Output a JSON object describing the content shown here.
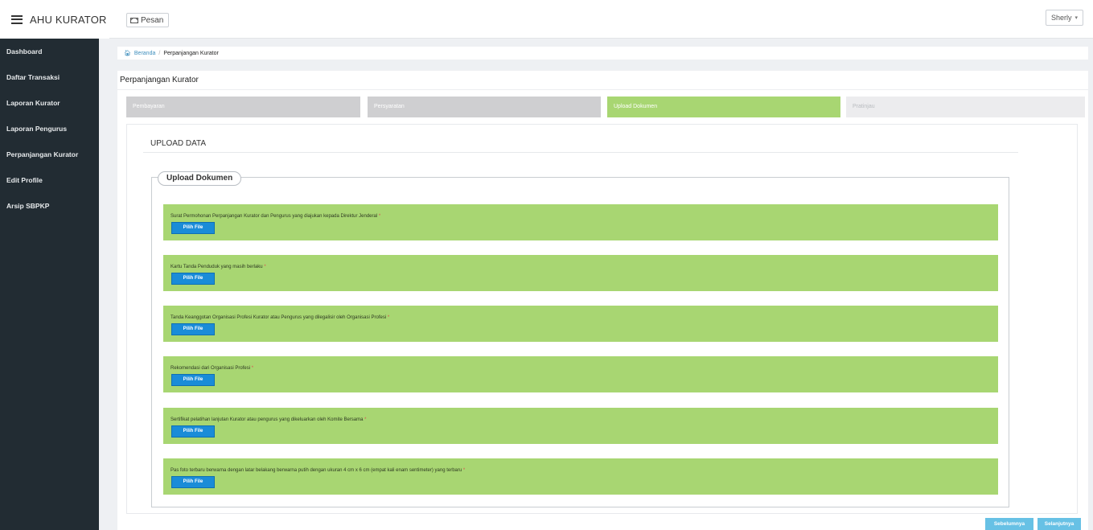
{
  "app": {
    "title": "AHU KURATOR"
  },
  "header": {
    "message_label": "Pesan",
    "user_label": "Sherly"
  },
  "sidebar": {
    "items": [
      {
        "label": "Dashboard"
      },
      {
        "label": "Daftar Transaksi"
      },
      {
        "label": "Laporan Kurator"
      },
      {
        "label": "Laporan Pengurus"
      },
      {
        "label": "Perpanjangan Kurator"
      },
      {
        "label": "Edit Profile"
      },
      {
        "label": "Arsip SBPKP"
      }
    ]
  },
  "breadcrumb": {
    "home": "Beranda",
    "current": "Perpanjangan Kurator"
  },
  "page": {
    "title": "Perpanjangan Kurator"
  },
  "steps": [
    {
      "label": "Pembayaran",
      "state": "done"
    },
    {
      "label": "Persyaratan",
      "state": "done"
    },
    {
      "label": "Upload Dokumen",
      "state": "current"
    },
    {
      "label": "Pratinjau",
      "state": "todo"
    }
  ],
  "section": {
    "title": "UPLOAD DATA",
    "legend": "Upload Dokumen"
  },
  "documents": [
    {
      "label": "Surat Permohonan Perpanjangan Kurator dan Pengurus yang diajukan kepada Direktur Jenderal",
      "required": "*",
      "button": "Pilih File"
    },
    {
      "label": "Kartu Tanda Penduduk yang masih berlaku",
      "required": "*",
      "button": "Pilih File"
    },
    {
      "label": "Tanda Keanggotan Organisasi Profesi Kurator atau Pengurus yang dilegalisir oleh Organisasi Profesi",
      "required": "*",
      "button": "Pilih File"
    },
    {
      "label": "Rekomendasi dari Organisasi Profesi",
      "required": "*",
      "button": "Pilih File"
    },
    {
      "label": "Sertifikat pelatihan lanjutan Kurator atau pengurus yang dikeluarkan oleh Komite Bersama",
      "required": "*",
      "button": "Pilih File"
    },
    {
      "label": "Pas foto terbaru berwarna dengan latar belakang berwarna putih dengan ukuran 4 cm x 6 cm (empat kali enam sentimeter) yang terbaru",
      "required": "*",
      "button": "Pilih File"
    }
  ],
  "actions": {
    "prev": "Sebelumnya",
    "next": "Selanjutnya"
  },
  "colors": {
    "sidebar": "#222c33",
    "step_current": "#a8d672",
    "step_done": "#cfcfd1",
    "button": "#1a8cd8",
    "nav_button": "#67c1e5",
    "required": "#d9534f"
  }
}
